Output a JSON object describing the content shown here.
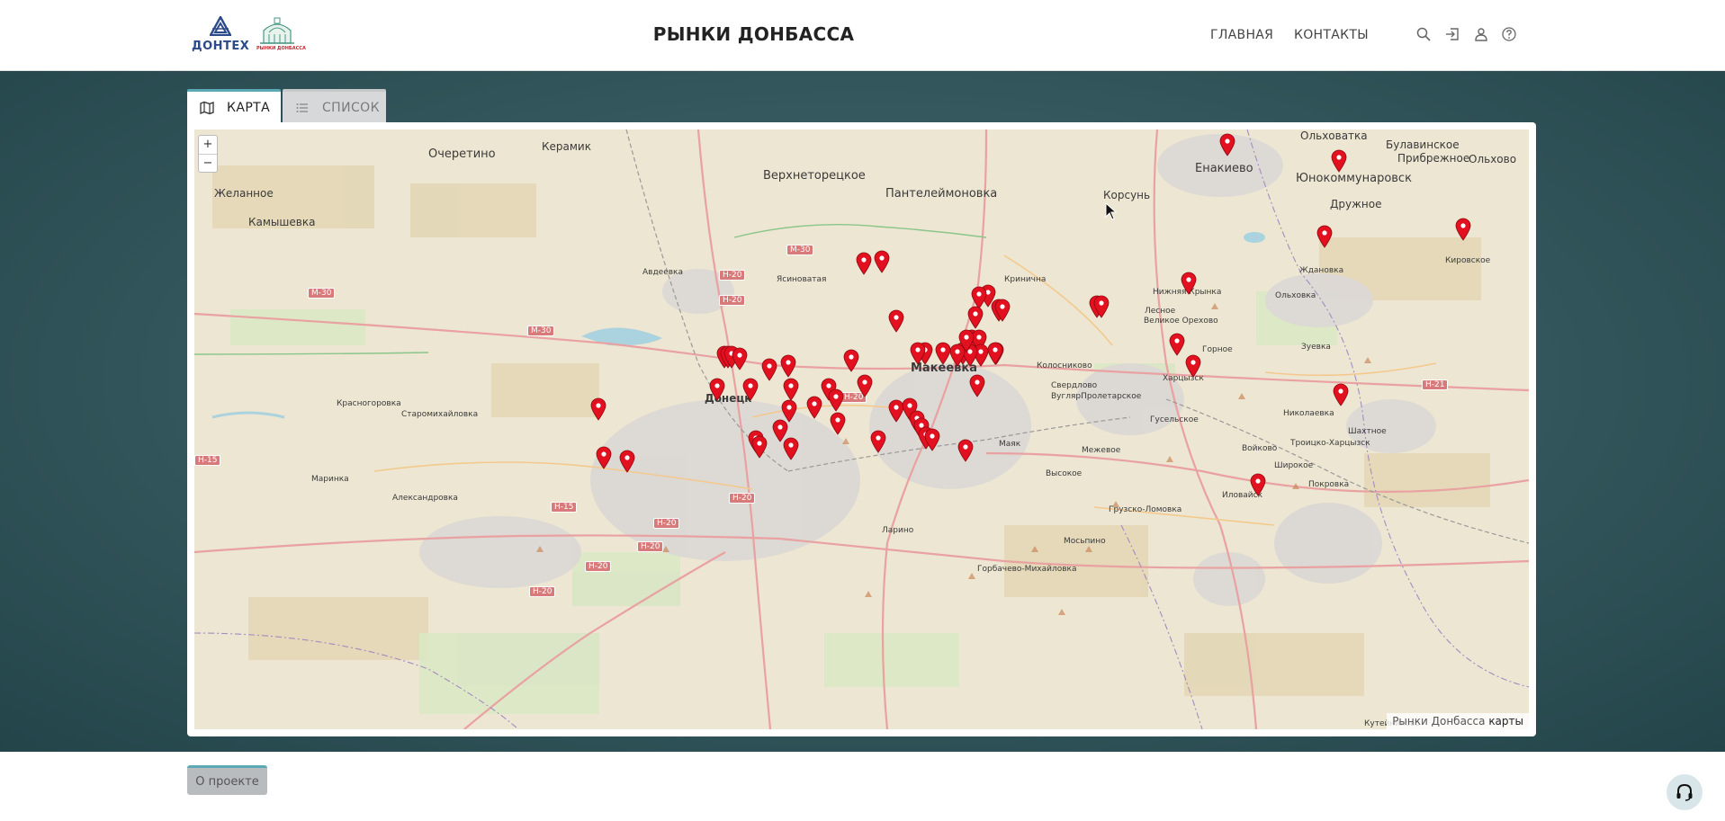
{
  "header": {
    "logo_dontech_text": "ДОНТЕХ",
    "logo_rynki_text": "РЫНКИ ДОНБАССА",
    "site_title": "РЫНКИ ДОНБАССА",
    "nav": {
      "main": "ГЛАВНАЯ",
      "contacts": "КОНТАКТЫ"
    },
    "icons": [
      "search-icon",
      "login-icon",
      "user-icon",
      "help-icon"
    ]
  },
  "tabs": {
    "map": "КАРТА",
    "list": "СПИСОК",
    "active": "map"
  },
  "map": {
    "zoom_in": "+",
    "zoom_out": "−",
    "attribution_prefix": "Рынки Донбасса",
    "attribution_link": "карты",
    "places": [
      {
        "name": "Керамик"
      },
      {
        "name": "Очеретино"
      },
      {
        "name": "Верхнеторецкое"
      },
      {
        "name": "Пантелеймоновка"
      },
      {
        "name": "Корсунь"
      },
      {
        "name": "Енакиево"
      },
      {
        "name": "Ольховатка"
      },
      {
        "name": "Булавинское"
      },
      {
        "name": "Прибрежное"
      },
      {
        "name": "Ольхово"
      },
      {
        "name": "Юнокоммунаровск"
      },
      {
        "name": "Дружное"
      },
      {
        "name": "Желанное"
      },
      {
        "name": "Камышевка"
      },
      {
        "name": "Авдеевка"
      },
      {
        "name": "Ясиноватая"
      },
      {
        "name": "Кировское"
      },
      {
        "name": "Ждановка"
      },
      {
        "name": "Кринична"
      },
      {
        "name": "Нижняя Крынка"
      },
      {
        "name": "Лесное"
      },
      {
        "name": "Великое Орехово"
      },
      {
        "name": "Ольховка"
      },
      {
        "name": "Макеевка"
      },
      {
        "name": "Колосниково"
      },
      {
        "name": "Свердлово"
      },
      {
        "name": "ВуглярПролетарское"
      },
      {
        "name": "Горное"
      },
      {
        "name": "Харцызск"
      },
      {
        "name": "Зуевка"
      },
      {
        "name": "Донецк"
      },
      {
        "name": "Красногоровка"
      },
      {
        "name": "Старомихайловка"
      },
      {
        "name": "Гусельское"
      },
      {
        "name": "Николаевка"
      },
      {
        "name": "Войково"
      },
      {
        "name": "Шахтное"
      },
      {
        "name": "Троицко-Харцызск"
      },
      {
        "name": "Широкое"
      },
      {
        "name": "Маринка"
      },
      {
        "name": "Александровка"
      },
      {
        "name": "Маяк"
      },
      {
        "name": "Межевое"
      },
      {
        "name": "Высокое"
      },
      {
        "name": "Покровка"
      },
      {
        "name": "Иловайск"
      },
      {
        "name": "Грузско-Ломовка"
      },
      {
        "name": "Мосьпино"
      },
      {
        "name": "Ларино"
      },
      {
        "name": "Горбачево-Михайловка"
      },
      {
        "name": "Кутейниково"
      }
    ],
    "roads": [
      "М-30",
      "М-30",
      "Н-20",
      "Н-20",
      "М-30",
      "Н-21",
      "Н-20",
      "Н-15",
      "Н-20",
      "Н-20",
      "Н-20",
      "Н-20",
      "Н-20",
      "Н-15"
    ],
    "marker_count": 63,
    "marker_color": "#e3101f"
  },
  "footer": {
    "about": "О проекте",
    "support_icon": "headset-icon"
  },
  "colors": {
    "accent": "#5aa9b4",
    "marker": "#e3101f",
    "logo_blue": "#2c4a8a",
    "logo_red": "#d21e2a"
  }
}
